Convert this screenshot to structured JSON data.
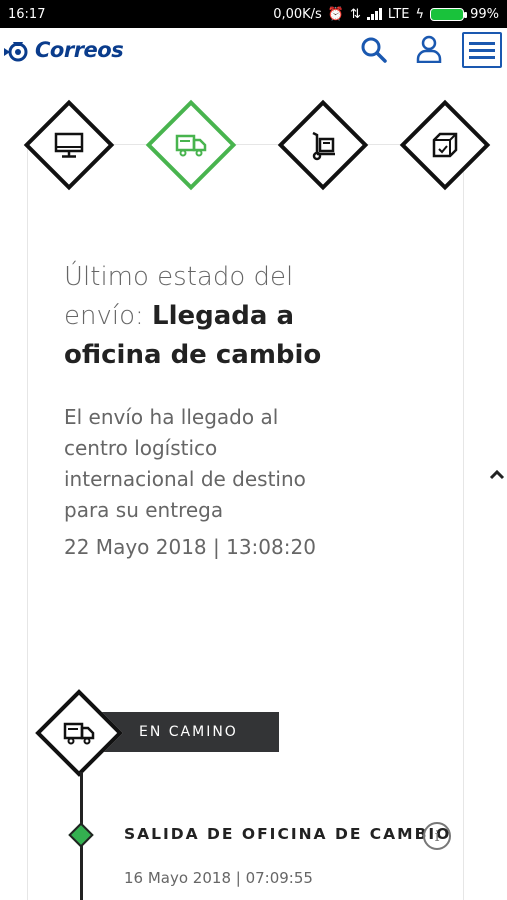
{
  "status_bar": {
    "time": "16:17",
    "speed": "0,00K/s",
    "network": "LTE",
    "battery": "99%"
  },
  "header": {
    "brand": "Correos"
  },
  "steps": [
    {
      "name": "online-step",
      "icon": "monitor-icon"
    },
    {
      "name": "transit-step",
      "icon": "truck-icon",
      "active": true
    },
    {
      "name": "delivery-step",
      "icon": "hand-truck-icon"
    },
    {
      "name": "delivered-step",
      "icon": "package-icon"
    }
  ],
  "status": {
    "heading": "Último estado del envío:",
    "value": "Llegada a oficina de cambio",
    "description": "El envío ha llegado al centro logístico internacional de destino para su entrega",
    "date": "22 Mayo 2018 | 13:08:20"
  },
  "timeline": {
    "phase_label": "EN CAMINO",
    "events": [
      {
        "title": "SALIDA DE OFICINA DE CAMBIO",
        "date": "16 Mayo 2018 | 07:09:55"
      }
    ]
  },
  "colors": {
    "brand_blue": "#1a58b0",
    "active_green": "#48b44e",
    "dark": "#333436"
  }
}
